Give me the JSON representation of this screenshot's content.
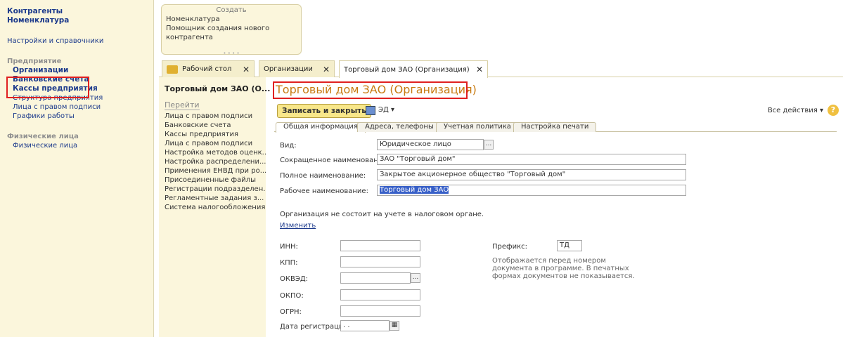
{
  "sidebar": {
    "top_links": [
      "Контрагенты",
      "Номенклатура"
    ],
    "settings_link": "Настройки и справочники",
    "enterprise_section": "Предприятие",
    "enterprise_items": [
      "Организации",
      "Банковские счета",
      "Кассы предприятия",
      "Структура предприятия",
      "Лица с правом подписи",
      "Графики работы"
    ],
    "persons_section": "Физические лица",
    "persons_items": [
      "Физические лица"
    ]
  },
  "create": {
    "title": "Создать",
    "items": [
      "Номенклатура",
      "Помощник создания нового контрагента"
    ]
  },
  "tabs": [
    "Рабочий стол",
    "Организации",
    "Торговый дом ЗАО (Организация)"
  ],
  "nav": {
    "doc_title": "Торговый дом ЗАО (О...",
    "go_label": "Перейти",
    "links": [
      "Лица с правом подписи",
      "Банковские счета",
      "Кассы предприятия",
      "Лица с правом подписи",
      "Настройка методов оценк...",
      "Настройка распределени...",
      "Применения ЕНВД при ро...",
      "Присоединенные файлы",
      "Регистрации подразделен...",
      "Регламентные задания з...",
      "Система налогообложения"
    ]
  },
  "form": {
    "title": "Торговый дом ЗАО (Организация)",
    "save_close": "Записать и закрыть",
    "ed": "ЭД ▾",
    "all_actions": "Все действия ▾",
    "help": "?",
    "tabs": [
      "Общая информация",
      "Адреса, телефоны",
      "Учетная политика",
      "Настройка печати"
    ],
    "vid_label": "Вид:",
    "vid_value": "Юридическое лицо",
    "short_name_label": "Сокращенное наименование:",
    "short_name_value": "ЗАО \"Торговый дом\"",
    "full_name_label": "Полное наименование:",
    "full_name_value": "Закрытое акционерное общество \"Торговый дом\"",
    "work_name_label": "Рабочее наименование:",
    "work_name_value": "Торговый дом ЗАО",
    "tax_note": "Организация не состоит на учете в налоговом органе.",
    "change_link": "Изменить",
    "inn_label": "ИНН:",
    "kpp_label": "КПП:",
    "okved_label": "ОКВЭД:",
    "okpo_label": "ОКПО:",
    "ogrn_label": "ОГРН:",
    "reg_date_label": "Дата регистрации:",
    "reg_date_value": " .  .",
    "prefix_label": "Префикс:",
    "prefix_value": "ТД",
    "prefix_note": "Отображается перед номером документа в программе. В печатных формах документов не показывается.",
    "pick_glyph": "..."
  }
}
